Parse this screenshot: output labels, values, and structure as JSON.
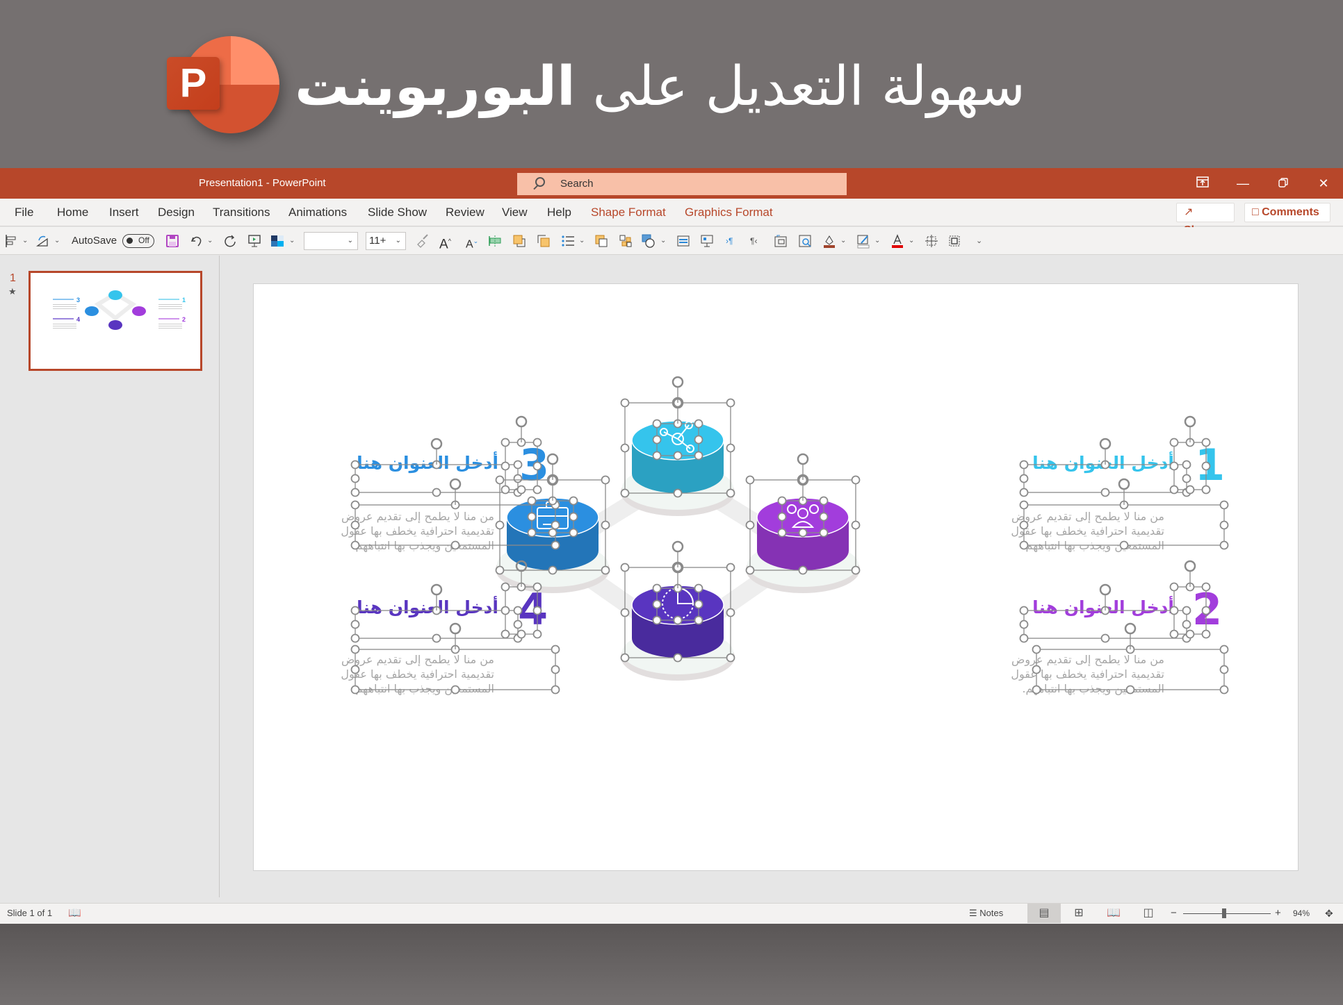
{
  "banner": {
    "logo_letter": "P",
    "title_regular": "سهولة التعديل على ",
    "title_bold": "البوربوينت"
  },
  "window": {
    "doc_title": "Presentation1  -  PowerPoint",
    "search_placeholder": "Search",
    "controls": [
      "restore-ribbon",
      "minimize",
      "maximize",
      "close"
    ]
  },
  "ribbon": {
    "tabs": [
      "File",
      "Home",
      "Insert",
      "Design",
      "Transitions",
      "Animations",
      "Slide Show",
      "Review",
      "View",
      "Help"
    ],
    "context_tabs": [
      "Shape Format",
      "Graphics Format"
    ],
    "share_label": "Share",
    "comments_label": "Comments"
  },
  "toolbar": {
    "autosave_label": "AutoSave",
    "autosave_state": "Off",
    "font_name": "",
    "font_size": "11+"
  },
  "sidebar": {
    "slide_number": "1",
    "transition_icon": "star-icon"
  },
  "slide": {
    "items": [
      {
        "number": "1",
        "heading": "أدخل العنوان هنا",
        "body": "من منا لا يطمح إلى تقديم عروض تقديمية احترافية يخطف بها عقول المستمعين ويجذب بها انتباههم.",
        "color": "#35C4EC",
        "icon": "network-icon"
      },
      {
        "number": "2",
        "heading": "أدخل العنوان هنا",
        "body": "من منا لا يطمح إلى تقديم عروض تقديمية احترافية يخطف بها عقول المستمعين ويجذب بها انتباههم.",
        "color": "#A23DDC",
        "icon": "users-icon"
      },
      {
        "number": "3",
        "heading": "أدخل العنوان هنا",
        "body": "من منا لا يطمح إلى تقديم عروض تقديمية احترافية يخطف بها عقول المستمعين ويجذب بها انتباههم.",
        "color": "#2B8FE0",
        "icon": "briefcase-icon"
      },
      {
        "number": "4",
        "heading": "أدخل العنوان هنا",
        "body": "من منا لا يطمح إلى تقديم عروض تقديمية احترافية يخطف بها عقول المستمعين ويجذب بها انتباههم.",
        "color": "#5935C0",
        "icon": "clock-icon"
      }
    ]
  },
  "statusbar": {
    "slide_info": "Slide 1 of 1",
    "notes_label": "Notes",
    "zoom_level": "94%",
    "zoom_fraction": 0.47
  }
}
